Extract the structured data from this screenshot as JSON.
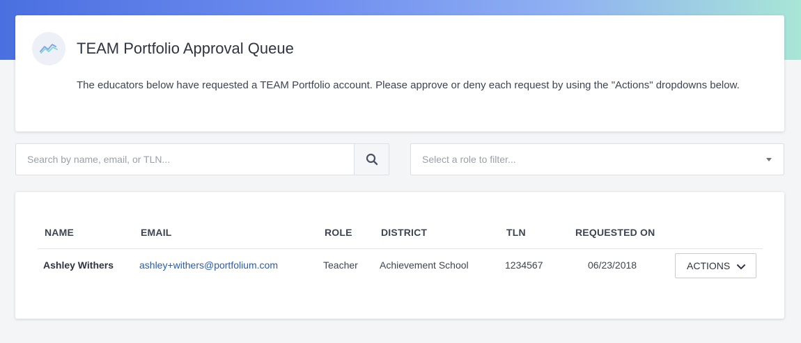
{
  "header": {
    "title": "TEAM Portfolio Approval Queue",
    "description": "The educators below have requested a TEAM Portfolio account. Please approve or deny each request by using the \"Actions\" dropdowns below."
  },
  "filters": {
    "search_placeholder": "Search by name, email, or TLN...",
    "role_placeholder": "Select a role to filter..."
  },
  "table": {
    "columns": [
      "NAME",
      "EMAIL",
      "ROLE",
      "DISTRICT",
      "TLN",
      "REQUESTED ON"
    ],
    "rows": [
      {
        "name": "Ashley Withers",
        "email": "ashley+withers@portfolium.com",
        "role": "Teacher",
        "district": "Achievement School",
        "tln": "1234567",
        "requested_on": "06/23/2018",
        "actions_label": "ACTIONS"
      }
    ]
  },
  "icons": {
    "logo": "trend-line-icon",
    "search": "search-icon",
    "select_caret": "caret-down-icon",
    "actions": "chevron-down-icon"
  },
  "colors": {
    "accent_gradient_start": "#4a6fe0",
    "accent_gradient_end": "#a8e6d6",
    "link": "#2a5ca8"
  }
}
